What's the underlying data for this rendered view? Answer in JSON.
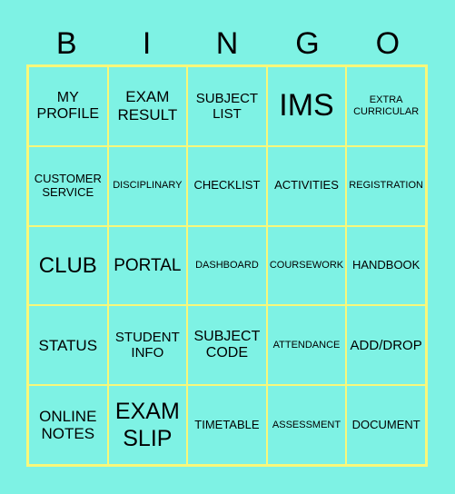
{
  "header": [
    "B",
    "I",
    "N",
    "G",
    "O"
  ],
  "cells": [
    [
      "MY\nPROFILE",
      "EXAM\nRESULT",
      "SUBJECT\nLIST",
      "IMS",
      "EXTRA\nCURRICULAR"
    ],
    [
      "CUSTOMER\nSERVICE",
      "DISCIPLINARY",
      "CHECKLIST",
      "ACTIVITIES",
      "REGISTRATION"
    ],
    [
      "CLUB",
      "PORTAL",
      "DASHBOARD",
      "COURSEWORK",
      "HANDBOOK"
    ],
    [
      "STATUS",
      "STUDENT\nINFO",
      "SUBJECT\nCODE",
      "ATTENDANCE",
      "ADD/DROP"
    ],
    [
      "ONLINE\nNOTES",
      "EXAM\nSLIP",
      "TIMETABLE",
      "ASSESSMENT",
      "DOCUMENT"
    ]
  ],
  "colors": {
    "background": "#7ef2e4",
    "grid_line": "#f8f87a",
    "text": "#000000"
  }
}
